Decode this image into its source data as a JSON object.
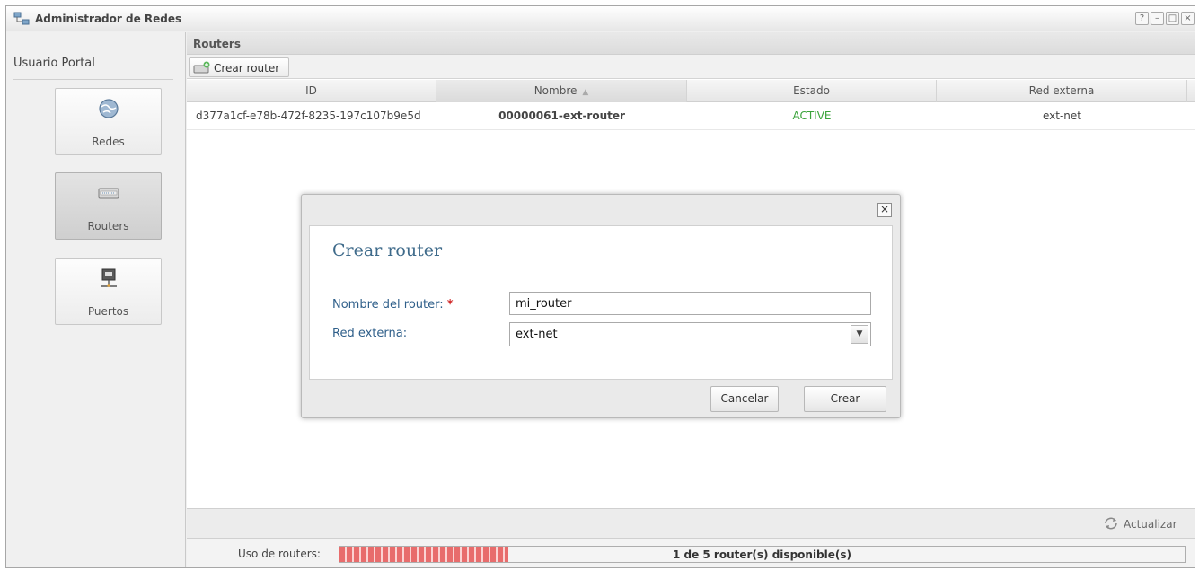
{
  "window": {
    "title": "Administrador de Redes",
    "controls": [
      "?",
      "–",
      "□",
      "×"
    ]
  },
  "sidebar": {
    "user_label": "Usuario Portal",
    "items": [
      {
        "label": "Redes",
        "icon": "globe-icon",
        "active": false
      },
      {
        "label": "Routers",
        "icon": "router-icon",
        "active": true
      },
      {
        "label": "Puertos",
        "icon": "network-port-icon",
        "active": false
      }
    ]
  },
  "panel": {
    "title": "Routers",
    "toolbar": {
      "create_label": "Crear router",
      "create_icon": "add-router-icon"
    },
    "columns": [
      "ID",
      "Nombre",
      "Estado",
      "Red externa"
    ],
    "sorted_column": "Nombre",
    "rows": [
      {
        "id": "d377a1cf-e78b-472f-8235-197c107b9e5d",
        "nombre": "00000061-ext-router",
        "estado": "ACTIVE",
        "red_externa": "ext-net"
      }
    ],
    "refresh_label": "Actualizar",
    "refresh_icon": "refresh-icon",
    "usage": {
      "label": "Uso de routers:",
      "text": "1 de 5 router(s) disponible(s)",
      "used_fraction": 0.2
    }
  },
  "dialog": {
    "title": "Crear router",
    "name_label": "Nombre del router:",
    "required_mark": "*",
    "name_value": "mi_router",
    "red_label": "Red externa:",
    "red_value": "ext-net",
    "cancel_label": "Cancelar",
    "create_label": "Crear",
    "close_glyph": "×"
  },
  "colors": {
    "status_active": "#3aa33a",
    "dialog_title": "#3e6a8a",
    "field_label": "#2f5f8a",
    "required": "#d12b2b",
    "usage_fill": "#e86c6c"
  }
}
